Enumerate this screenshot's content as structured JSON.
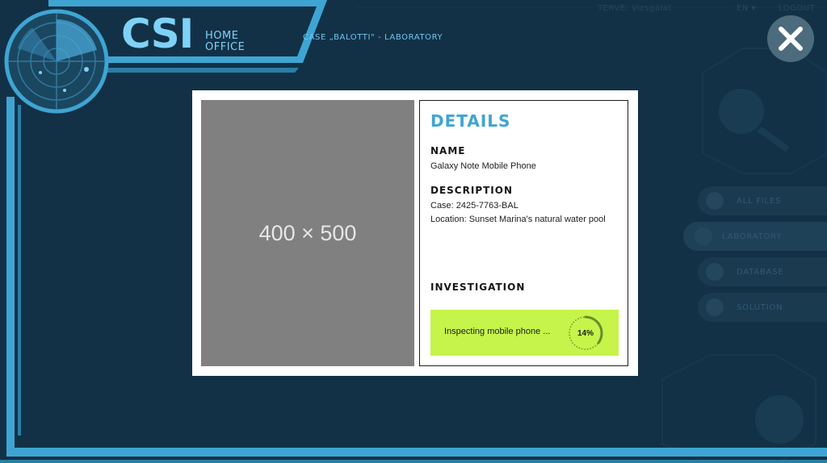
{
  "header": {
    "logo_text": "CSI",
    "logo_sub": "HOME OFFICE",
    "case_title": "CASE „BALOTTI\" - LABORATORY"
  },
  "top_menu": {
    "left_text": "TERVE: Vizsgálat",
    "lang": "EN ▾",
    "logout": "LOGOUT"
  },
  "side_nav": {
    "items": [
      {
        "label": "ALL FILES",
        "icon": "folder-icon"
      },
      {
        "label": "LABORATORY",
        "icon": "microscope-icon"
      },
      {
        "label": "DATABASE",
        "icon": "database-icon"
      },
      {
        "label": "SOLUTION",
        "icon": "lightbulb-icon"
      }
    ],
    "active_index": 1
  },
  "modal": {
    "placeholder_text": "400 × 500",
    "title": "DETAILS",
    "name_label": "NAME",
    "name_value": "Galaxy Note Mobile Phone",
    "description_label": "DESCRIPTION",
    "description_case": "Case: 2425-7763-BAL",
    "description_location": "Location: Sunset Marina's natural water pool",
    "investigation_label": "INVESTIGATION",
    "progress_text": "Inspecting mobile phone ...",
    "progress_percent_label": "14%",
    "progress_fraction": 0.14
  },
  "colors": {
    "background": "#123147",
    "frame": "#3ea5d3",
    "accent_text": "#7fd2f7",
    "progress_bg": "#c6f44a",
    "details_title": "#3ea5d3"
  }
}
